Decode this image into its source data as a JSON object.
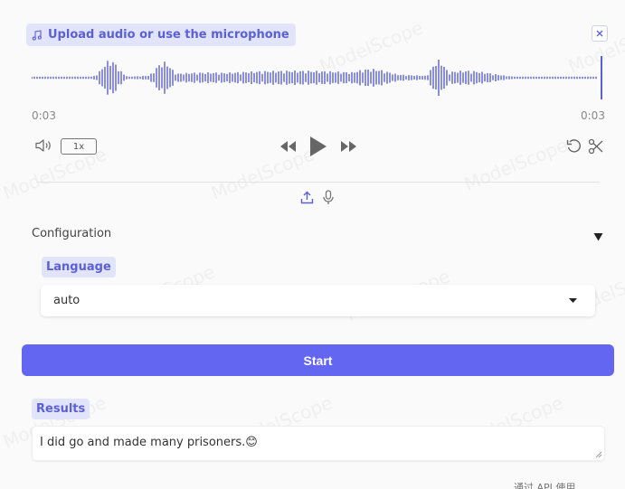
{
  "audio": {
    "upload_label": "Upload audio or use the microphone",
    "upload_icon": "music-note-icon",
    "current_time": "0:03",
    "duration": "0:03",
    "speed": "1x",
    "progress": 1.0,
    "accent_color": "#5b60d6"
  },
  "config": {
    "title": "Configuration",
    "language_label": "Language",
    "language_value": "auto"
  },
  "actions": {
    "start_label": "Start",
    "button_color": "#6366f1"
  },
  "results": {
    "label": "Results",
    "text": "I did go and made many prisoners.",
    "emoji": "😊"
  },
  "footer": {
    "api_text": "通过 API 使用"
  },
  "watermark": {
    "text": "ModelScope"
  }
}
